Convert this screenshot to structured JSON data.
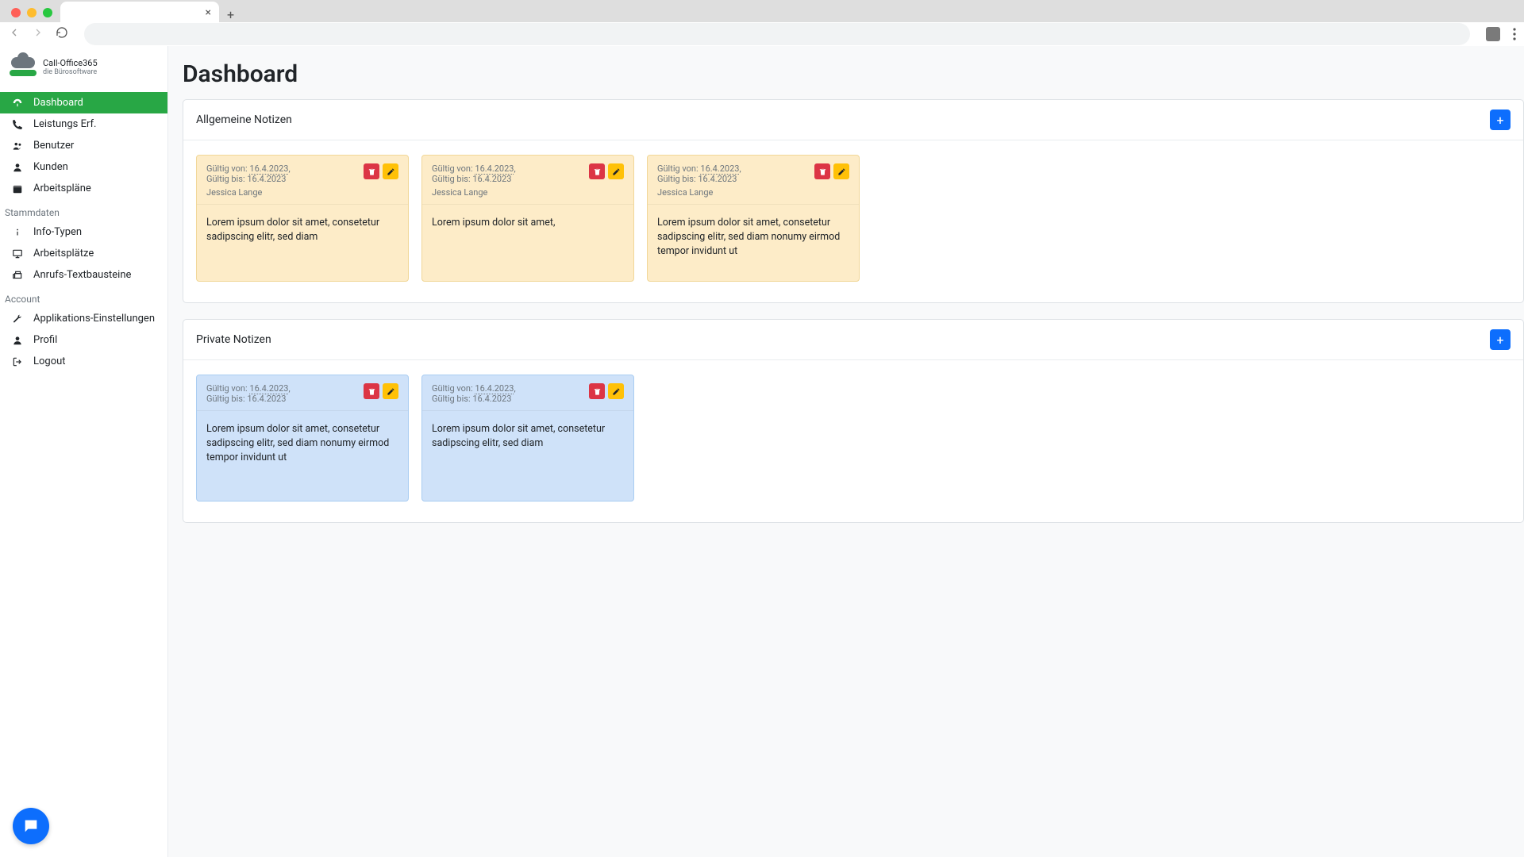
{
  "logo": {
    "line1": "Call-Office365",
    "line2": "die Bürosoftware"
  },
  "sidebar": {
    "items": [
      {
        "label": "Dashboard",
        "icon": "gauge-icon",
        "active": true
      },
      {
        "label": "Leistungs Erf.",
        "icon": "phone-icon"
      },
      {
        "label": "Benutzer",
        "icon": "users-icon"
      },
      {
        "label": "Kunden",
        "icon": "user-icon"
      },
      {
        "label": "Arbeitspläne",
        "icon": "calendar-icon"
      }
    ],
    "section1": "Stammdaten",
    "items_stammdaten": [
      {
        "label": "Info-Typen",
        "icon": "info-icon"
      },
      {
        "label": "Arbeitsplätze",
        "icon": "desktop-icon"
      },
      {
        "label": "Anrufs-Textbausteine",
        "icon": "fax-icon"
      }
    ],
    "section2": "Account",
    "items_account": [
      {
        "label": "Applikations-Einstellungen",
        "icon": "wrench-icon"
      },
      {
        "label": "Profil",
        "icon": "user-icon"
      },
      {
        "label": "Logout",
        "icon": "logout-icon"
      }
    ]
  },
  "page_title": "Dashboard",
  "panels": {
    "general": {
      "title": "Allgemeine Notizen",
      "notes": [
        {
          "valid_from_label": "Gültig von:",
          "valid_from": "16.4.2023",
          "valid_to_label": "Gültig bis:",
          "valid_to": "16.4.2023",
          "author": "Jessica Lange",
          "body": "Lorem ipsum dolor sit amet, consetetur sadipscing elitr, sed diam"
        },
        {
          "valid_from_label": "Gültig von:",
          "valid_from": "16.4.2023",
          "valid_to_label": "Gültig bis:",
          "valid_to": "16.4.2023",
          "author": "Jessica Lange",
          "body": "Lorem ipsum dolor sit amet,"
        },
        {
          "valid_from_label": "Gültig von:",
          "valid_from": "16.4.2023",
          "valid_to_label": "Gültig bis:",
          "valid_to": "16.4.2023",
          "author": "Jessica Lange",
          "body": "Lorem ipsum dolor sit amet, consetetur sadipscing elitr, sed diam nonumy eirmod tempor invidunt ut"
        }
      ]
    },
    "private": {
      "title": "Private Notizen",
      "notes": [
        {
          "valid_from_label": "Gültig von:",
          "valid_from": "16.4.2023",
          "valid_to_label": "Gültig bis:",
          "valid_to": "16.4.2023",
          "body": "Lorem ipsum dolor sit amet, consetetur sadipscing elitr, sed diam nonumy eirmod tempor invidunt ut"
        },
        {
          "valid_from_label": "Gültig von:",
          "valid_from": "16.4.2023",
          "valid_to_label": "Gültig bis:",
          "valid_to": "16.4.2023",
          "body": "Lorem ipsum dolor sit amet, consetetur sadipscing elitr, sed diam"
        }
      ]
    }
  }
}
